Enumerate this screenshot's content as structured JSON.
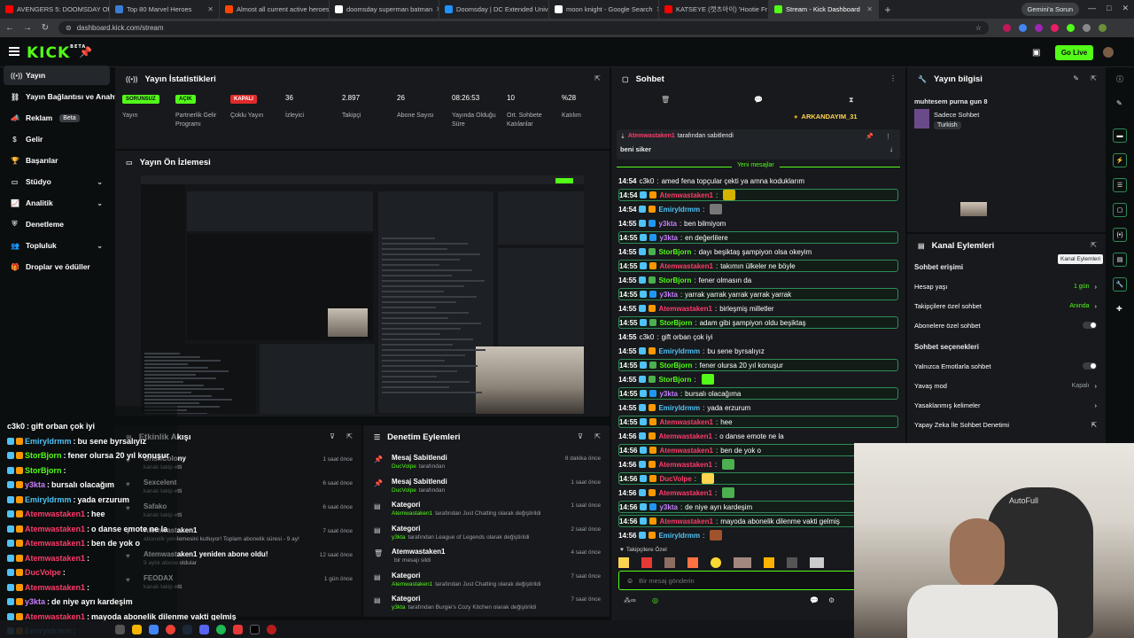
{
  "browser": {
    "tabs": [
      {
        "label": "AVENGERS 5: DOOMSDAY Offi",
        "color": "#ff0000"
      },
      {
        "label": "Top 80 Marvel Heroes",
        "color": "#3a7bd5"
      },
      {
        "label": "Almost all current active heroes",
        "color": "#ff4500"
      },
      {
        "label": "doomsday superman batman",
        "color": "#ffffff"
      },
      {
        "label": "Doomsday | DC Extended Univ",
        "color": "#1e90ff"
      },
      {
        "label": "moon knight - Google Search",
        "color": "#ffffff"
      },
      {
        "label": "KATSEYE (캣츠아이) 'Hootie Fr",
        "color": "#ff0000"
      },
      {
        "label": "Stream - Kick Dashboard",
        "color": "#53fc18"
      }
    ],
    "gemini_label": "Gemini'a Sorun",
    "url": "dashboard.kick.com/stream"
  },
  "header": {
    "logo": "KICK",
    "logo_sup": "BETA",
    "go_live": "Go Live"
  },
  "sidebar": {
    "items": [
      {
        "label": "Yayın",
        "icon": "signal"
      },
      {
        "label": "Yayın Bağlantısı ve Anahta",
        "icon": "link"
      },
      {
        "label": "Reklam",
        "icon": "megaphone",
        "badge": "Beta"
      },
      {
        "label": "Gelir",
        "icon": "dollar"
      },
      {
        "label": "Başarılar",
        "icon": "trophy"
      },
      {
        "label": "Stüdyo",
        "icon": "video",
        "expand": true
      },
      {
        "label": "Analitik",
        "icon": "chart",
        "expand": true
      },
      {
        "label": "Denetleme",
        "icon": "shield"
      },
      {
        "label": "Topluluk",
        "icon": "users",
        "expand": true
      },
      {
        "label": "Droplar ve ödüller",
        "icon": "gift"
      }
    ]
  },
  "stats": {
    "title": "Yayın İstatistikleri",
    "items": [
      {
        "value": "SORUNSUZ",
        "label": "Yayın",
        "badge": "yellow"
      },
      {
        "value": "AÇIK",
        "label": "Partnerlik Gelir Programı",
        "badge": "green"
      },
      {
        "value": "KAPALI",
        "label": "Çoklu Yayın",
        "badge": "red"
      },
      {
        "value": "36",
        "label": "İzleyici"
      },
      {
        "value": "2.897",
        "label": "Takipçi"
      },
      {
        "value": "26",
        "label": "Abone Sayısı"
      },
      {
        "value": "08:26:53",
        "label": "Yayında Olduğu Süre"
      },
      {
        "value": "10",
        "label": "Ort. Sohbete Katılanlar"
      },
      {
        "value": "%28",
        "label": "Katılım"
      }
    ]
  },
  "preview": {
    "title": "Yayın Ön İzlemesi"
  },
  "activity": {
    "title": "Etkinlik Akışı",
    "items": [
      {
        "name": "GrishColony",
        "sub": "kanalı takip etti",
        "time": "1 saat önce"
      },
      {
        "name": "Sexcelent",
        "sub": "kanalı takip etti",
        "time": "6 saat önce"
      },
      {
        "name": "Safako",
        "sub": "kanalı takip etti",
        "time": "6 saat önce"
      },
      {
        "name": "Atemwastaken1",
        "sub": "abonelik yenilemesini kutluyor! Toplam abonelik süresi - 9 ay!",
        "time": "7 saat önce"
      },
      {
        "name": "Atemwastaken1 yeniden abone oldu!",
        "sub": "9 aylık abone oldular",
        "time": "12 saat önce"
      },
      {
        "name": "FEODAX",
        "sub": "kanalı takip etti",
        "time": "1 gün önce"
      }
    ]
  },
  "modlog": {
    "title": "Denetim Eylemleri",
    "items": [
      {
        "title": "Mesaj Sabitlendi",
        "actor": "DucVolpe",
        "rest": "tarafından",
        "time": "8 dakika önce"
      },
      {
        "title": "Mesaj Sabitlendi",
        "actor": "DucVolpe",
        "rest": "tarafından",
        "time": "1 saat önce"
      },
      {
        "title": "Kategori",
        "actor": "Atemwastaken1",
        "rest": "tarafından Just Chatting olarak değiştirildi",
        "time": "1 saat önce"
      },
      {
        "title": "Kategori",
        "actor": "y3kta",
        "rest": "tarafından League of Legends olarak değiştirildi",
        "time": "2 saat önce"
      },
      {
        "title": "Atemwastaken1",
        "actor": "",
        "rest": "bir mesajı sildi",
        "time": "4 saat önce"
      },
      {
        "title": "Kategori",
        "actor": "Atemwastaken1",
        "rest": "tarafından Just Chatting olarak değiştirildi",
        "time": "7 saat önce"
      },
      {
        "title": "Kategori",
        "actor": "y3kta",
        "rest": "tarafından Burgie's Cozy Kitchen olarak değiştirildi",
        "time": "7 saat önce"
      }
    ]
  },
  "chat": {
    "title": "Sohbet",
    "top_user": "ARKANDAYIM_31",
    "pinned_by": "Atemwastaken1",
    "pinned_suffix": "tarafından sabitlendi",
    "pinned_msg": "beni siker",
    "new_messages": "Yeni mesajlar",
    "messages": [
      {
        "time": "14:54",
        "user": "c3k0",
        "color": "plain",
        "text": "amed fena topçular çekti ya amna koduklarım"
      },
      {
        "time": "14:54",
        "user": "Atemwastaken1",
        "color": "red",
        "text": "",
        "emote": "#d4b400",
        "hl": true
      },
      {
        "time": "14:54",
        "user": "Emiryldrmm",
        "color": "blue",
        "text": "",
        "emote": "#777"
      },
      {
        "time": "14:55",
        "user": "y3kta",
        "color": "purple",
        "text": "ben bilmiyom"
      },
      {
        "time": "14:55",
        "user": "y3kta",
        "color": "purple",
        "text": "en değerlilere",
        "hl": true
      },
      {
        "time": "14:55",
        "user": "StorBjorn",
        "color": "green",
        "text": "dayı beşiktaş şampiyon olsa okeyim"
      },
      {
        "time": "14:55",
        "user": "Atemwastaken1",
        "color": "red",
        "text": "takımın ülkeler ne böyle",
        "hl": true
      },
      {
        "time": "14:55",
        "user": "StorBjorn",
        "color": "green",
        "text": "fener olmasın da"
      },
      {
        "time": "14:55",
        "user": "y3kta",
        "color": "purple",
        "text": "yarrak yarrak yarrak yarrak yarrak",
        "hl": true
      },
      {
        "time": "14:55",
        "user": "Atemwastaken1",
        "color": "red",
        "text": "birleşmiş milletler"
      },
      {
        "time": "14:55",
        "user": "StorBjorn",
        "color": "green",
        "text": "adam gibi şampiyon oldu beşiktaş",
        "hl": true
      },
      {
        "time": "14:55",
        "user": "c3k0",
        "color": "plain",
        "text": "gift orban çok iyi"
      },
      {
        "time": "14:55",
        "user": "Emiryldrmm",
        "color": "blue",
        "text": "bu sene byrsalıyız"
      },
      {
        "time": "14:55",
        "user": "StorBjorn",
        "color": "green",
        "text": "fener olursa 20 yıl konuşur",
        "hl": true
      },
      {
        "time": "14:55",
        "user": "StorBjorn",
        "color": "green",
        "text": "",
        "emote": "#53fc18"
      },
      {
        "time": "14:55",
        "user": "y3kta",
        "color": "purple",
        "text": "bursalı olacağıma",
        "hl": true
      },
      {
        "time": "14:55",
        "user": "Emiryldrmm",
        "color": "blue",
        "text": "yada erzurum"
      },
      {
        "time": "14:55",
        "user": "Atemwastaken1",
        "color": "red",
        "text": "hee",
        "hl": true
      },
      {
        "time": "14:56",
        "user": "Atemwastaken1",
        "color": "red",
        "text": "o danse emote ne la"
      },
      {
        "time": "14:56",
        "user": "Atemwastaken1",
        "color": "red",
        "text": "ben de yok o",
        "hl": true
      },
      {
        "time": "14:56",
        "user": "Atemwastaken1",
        "color": "red",
        "text": "",
        "emote": "#4caf50"
      },
      {
        "time": "14:56",
        "user": "DucVolpe",
        "color": "red",
        "text": "",
        "emote": "#ffd54f",
        "hl": true
      },
      {
        "time": "14:56",
        "user": "Atemwastaken1",
        "color": "red",
        "text": "",
        "emote": "#4caf50"
      },
      {
        "time": "14:56",
        "user": "y3kta",
        "color": "purple",
        "text": "de niye ayrı kardeşim",
        "hl": true
      },
      {
        "time": "14:56",
        "user": "Atemwastaken1",
        "color": "red",
        "text": "mayoda abonelik dilenme vakti gelmiş",
        "hl": true
      },
      {
        "time": "14:56",
        "user": "Emiryldrmm",
        "color": "blue",
        "text": "",
        "emote": "#a0522d"
      }
    ],
    "followers_only": "Takipçilere Özel",
    "placeholder": "Bir mesaj gönderin"
  },
  "stream_info": {
    "title": "Yayın bilgisi",
    "stream_title": "muhtesem purna gun 8",
    "category": "Sadece Sohbet",
    "tag": "Turkish"
  },
  "channel_actions": {
    "title": "Kanal Eylemleri",
    "tooltip": "Kanal Eylemleri",
    "chat_access": "Sohbet erişimi",
    "account_age": {
      "label": "Hesap yaşı",
      "value": "1 gün"
    },
    "followers_chat": {
      "label": "Takipçilere özel sohbet",
      "value": "Anında"
    },
    "subs_chat": {
      "label": "Abonelere özel sohbet"
    },
    "chat_options": "Sohbet seçenekleri",
    "emote_only": {
      "label": "Yalnızca Emotlarla sohbet"
    },
    "slow_mode": {
      "label": "Yavaş mod",
      "value": "Kapalı"
    },
    "banned_words": {
      "label": "Yasaklanmış kelimeler"
    },
    "ai_mod": {
      "label": "Yapay Zeka İle Sohbet Denetimi"
    }
  },
  "overlay": {
    "lines": [
      {
        "user": "c3k0",
        "color": "plain",
        "text": "gift orban çok iyi"
      },
      {
        "user": "Emiryldrmm",
        "color": "blue",
        "text": "bu sene byrsalıyız"
      },
      {
        "user": "StorBjorn",
        "color": "green",
        "text": "fener olursa 20 yıl konuşur"
      },
      {
        "user": "StorBjorn",
        "color": "green",
        "text": ""
      },
      {
        "user": "y3kta",
        "color": "purple",
        "text": "bursalı olacağım"
      },
      {
        "user": "Emiryldrmm",
        "color": "blue",
        "text": "yada erzurum"
      },
      {
        "user": "Atemwastaken1",
        "color": "red",
        "text": "hee"
      },
      {
        "user": "Atemwastaken1",
        "color": "red",
        "text": "o danse emote ne la"
      },
      {
        "user": "Atemwastaken1",
        "color": "red",
        "text": "ben de yok o"
      },
      {
        "user": "Atemwastaken1",
        "color": "red",
        "text": ""
      },
      {
        "user": "DucVolpe",
        "color": "red",
        "text": ""
      },
      {
        "user": "Atemwastaken1",
        "color": "red",
        "text": ""
      },
      {
        "user": "y3kta",
        "color": "purple",
        "text": "de niye ayrı kardeşim"
      },
      {
        "user": "Atemwastaken1",
        "color": "red",
        "text": "mayoda abonelik dilenme vakti gelmiş"
      },
      {
        "user": "Emiryldrmm",
        "color": "blue",
        "text": ""
      }
    ]
  },
  "webcam": {
    "brand": "AutoFull"
  }
}
